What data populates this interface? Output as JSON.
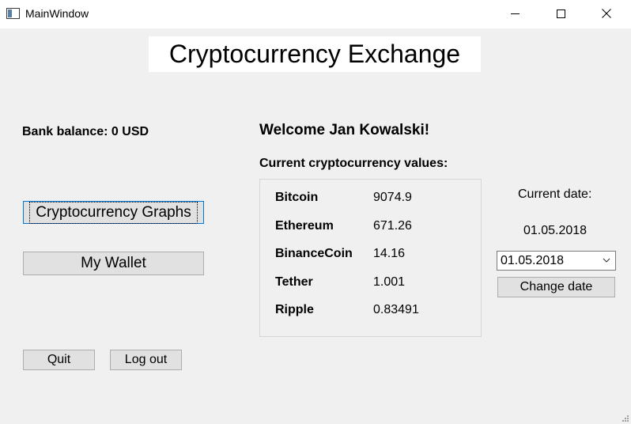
{
  "window": {
    "title": "MainWindow"
  },
  "header": {
    "title": "Cryptocurrency Exchange"
  },
  "bank": {
    "label": "Bank balance:  0 USD"
  },
  "welcome": "Welcome Jan Kowalski!",
  "values_title": "Current cryptocurrency values:",
  "cryptos": [
    {
      "name": "Bitcoin",
      "value": "9074.9"
    },
    {
      "name": "Ethereum",
      "value": "671.26"
    },
    {
      "name": "BinanceCoin",
      "value": "14.16"
    },
    {
      "name": "Tether",
      "value": "1.001"
    },
    {
      "name": "Ripple",
      "value": "0.83491"
    }
  ],
  "buttons": {
    "graphs": "Cryptocurrency Graphs",
    "wallet": "My Wallet",
    "quit": "Quit",
    "logout": "Log out",
    "change_date": "Change date"
  },
  "date": {
    "label": "Current date:",
    "current": "01.05.2018",
    "selected": "01.05.2018"
  },
  "icons": {
    "app": "window-app-icon",
    "minimize": "minimize-icon",
    "maximize": "maximize-icon",
    "close": "close-icon",
    "dropdown": "chevron-down-icon",
    "resize": "resize-grip-icon"
  },
  "colors": {
    "background": "#f0f0f0",
    "button": "#e1e1e1",
    "focus": "#0078d7"
  }
}
